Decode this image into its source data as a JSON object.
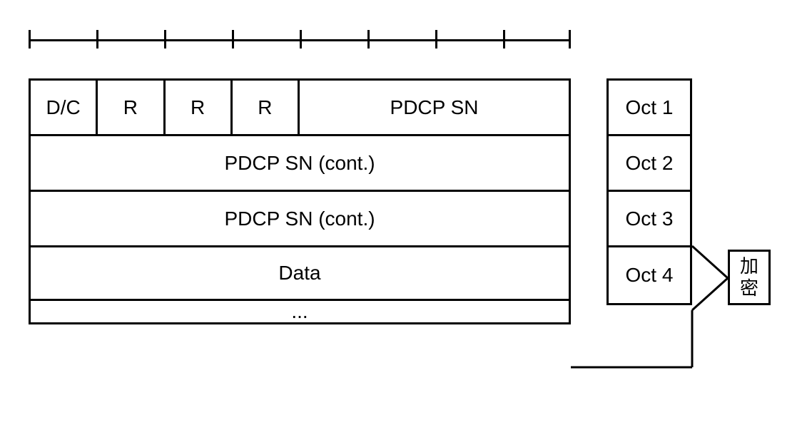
{
  "ruler": {
    "ticks": 9
  },
  "pdu": {
    "row1": {
      "dc": "D/C",
      "r1": "R",
      "r2": "R",
      "r3": "R",
      "sn": "PDCP SN"
    },
    "row2": "PDCP SN (cont.)",
    "row3": "PDCP SN (cont.)",
    "row4": "Data",
    "row5": "..."
  },
  "oct": {
    "r1": "Oct 1",
    "r2": "Oct 2",
    "r3": "Oct 3",
    "r4": "Oct 4"
  },
  "cipher": {
    "line1": "加",
    "line2": "密"
  }
}
